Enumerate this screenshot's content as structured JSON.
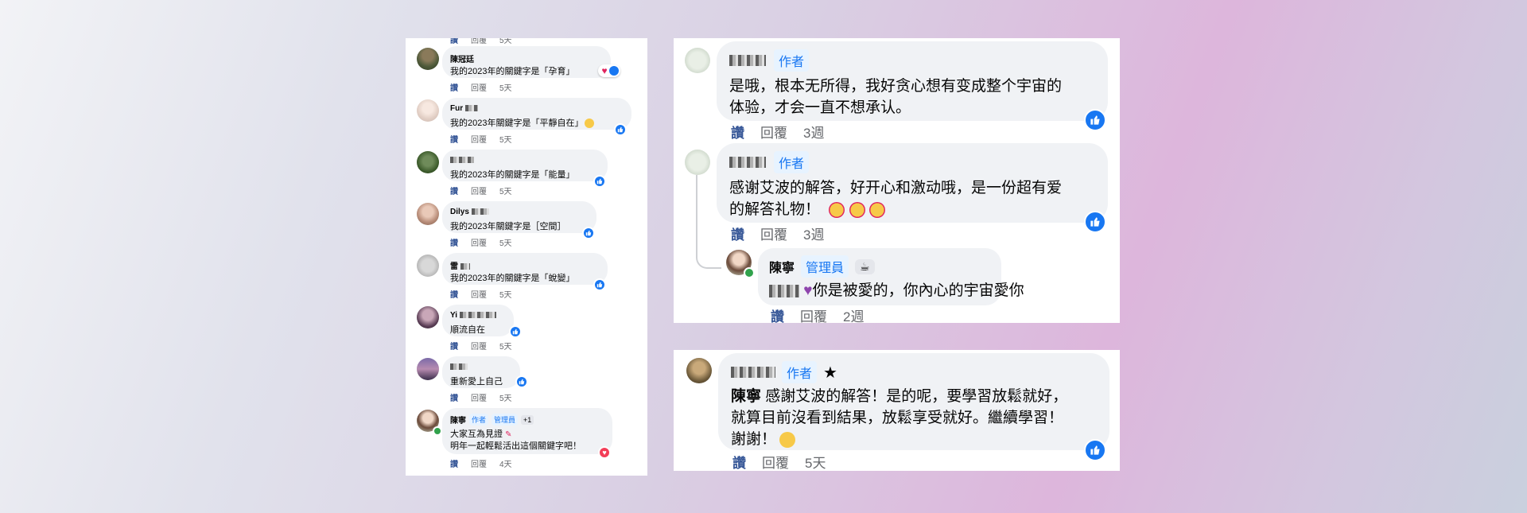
{
  "left_panel": {
    "top_cut": {
      "like": "讚",
      "reply": "回覆",
      "time": "5天"
    },
    "comments": [
      {
        "name": "陳冠廷",
        "text": "我的2023年的關鍵字是「孕育」",
        "like": "讚",
        "reply": "回覆",
        "time": "5天",
        "reaction": "heart-emoji"
      },
      {
        "name": "Fur",
        "text": "我的2023年關鍵字是「平靜自在」",
        "like": "讚",
        "reply": "回覆",
        "time": "5天",
        "reaction": "smile-emoji"
      },
      {
        "name": "",
        "text": "我的2023年的關鍵字是「能量」",
        "like": "讚",
        "reply": "回覆",
        "time": "5天"
      },
      {
        "name": "Dilys",
        "text": "我的2023年關鍵字是［空間］",
        "like": "讚",
        "reply": "回覆",
        "time": "5天"
      },
      {
        "name": "雷",
        "text": "我的2023年的關鍵字是「蛻變」",
        "like": "讚",
        "reply": "回覆",
        "time": "5天"
      },
      {
        "name": "Yi",
        "text": "順流自在",
        "like": "讚",
        "reply": "回覆",
        "time": "5天"
      },
      {
        "name": "",
        "text": "重新愛上自己",
        "like": "讚",
        "reply": "回覆",
        "time": "5天"
      }
    ],
    "last": {
      "name": "陳寧",
      "tag_author": "作者",
      "tag_admin": "管理員",
      "plus": "+1",
      "line1": "大家互為見證",
      "line2": "明年一起輕鬆活出這個關鍵字吧！",
      "like": "讚",
      "reply": "回覆",
      "time": "4天"
    }
  },
  "right_top": {
    "c1": {
      "tag": "作者",
      "line1": "是哦，根本无所得，我好贪心想有变成整个宇宙的",
      "line2": "体验，才会一直不想承认。",
      "like": "讚",
      "reply": "回覆",
      "time": "3週"
    },
    "c2": {
      "tag": "作者",
      "line1": "感谢艾波的解答，好开心和激动哦，是一份超有爱",
      "line2": "的解答礼物！",
      "like": "讚",
      "reply": "回覆",
      "time": "3週"
    },
    "c3": {
      "name": "陳寧",
      "tag": "管理員",
      "text": "你是被愛的，你內心的宇宙愛你",
      "like": "讚",
      "reply": "回覆",
      "time": "2週"
    }
  },
  "right_bottom": {
    "c1": {
      "tag": "作者",
      "mention": "陳寧",
      "line1": "感謝艾波的解答！是的呢，要學習放鬆就好，",
      "line2": "就算目前沒看到結果，放鬆享受就好。繼續學習！",
      "line3": "謝謝！",
      "like": "讚",
      "reply": "回覆",
      "time": "5天"
    }
  },
  "colors": {
    "accent": "#1877f2",
    "bubble": "#f0f2f5",
    "meta": "#65676b"
  }
}
